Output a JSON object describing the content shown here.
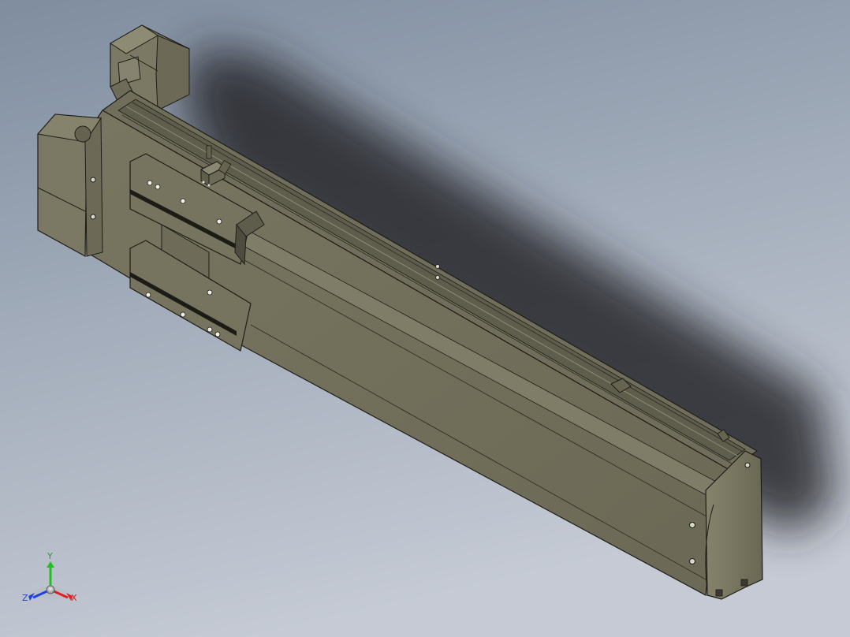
{
  "viewport": {
    "background_top": "#8b98a8",
    "background_bottom": "#c2c8d2",
    "model_name": "linear-actuator-module"
  },
  "colors": {
    "body_main": "#75735e",
    "body_dark": "#5e5c4a",
    "body_light": "#8a8870",
    "body_top": "#6f6d59",
    "edge": "#1e1e18",
    "motor": "#7a7862",
    "shadow": "#2e3036"
  },
  "triad": {
    "x_label": "X",
    "y_label": "Y",
    "z_label": "Z",
    "x_color": "#e02020",
    "y_color": "#20c020",
    "z_color": "#2040e0"
  }
}
